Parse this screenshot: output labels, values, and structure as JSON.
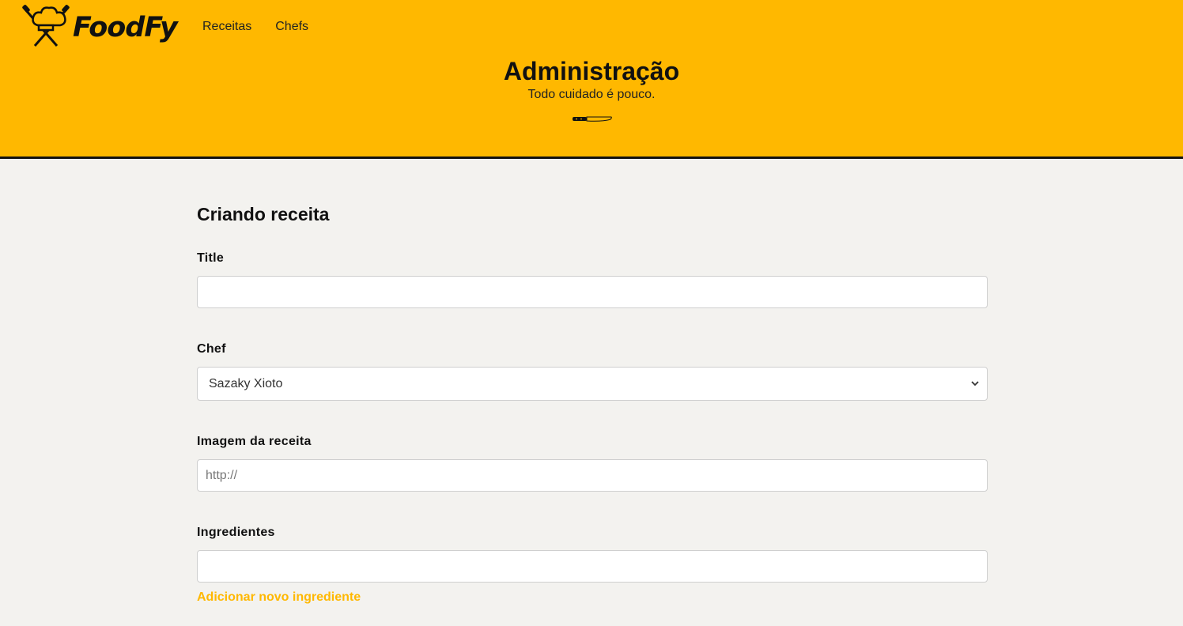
{
  "brand": {
    "name": "FoodFy",
    "accent": "#ffb800"
  },
  "nav": [
    {
      "label": "Receitas"
    },
    {
      "label": "Chefs"
    }
  ],
  "hero": {
    "title": "Administração",
    "subtitle": "Todo cuidado é pouco."
  },
  "form": {
    "heading": "Criando receita",
    "title_label": "Title",
    "title_value": "",
    "chef_label": "Chef",
    "chef_selected": "Sazaky Xioto",
    "image_label": "Imagem da receita",
    "image_placeholder": "http://",
    "ingredients_label": "Ingredientes",
    "ingredient_value": "",
    "add_ingredient": "Adicionar novo ingrediente"
  },
  "icons": {
    "logo": "chef-hat-knives-icon",
    "divider": "knife-icon",
    "select": "chevron-down-icon"
  }
}
